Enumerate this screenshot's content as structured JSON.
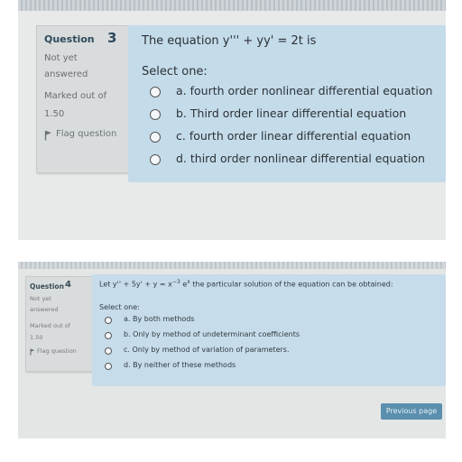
{
  "q3": {
    "question_label": "Question",
    "question_number": "3",
    "status": [
      "Not yet",
      "answered"
    ],
    "marked_out_of": "Marked out of",
    "marks": "1.50",
    "flag": "Flag question",
    "prompt": "The equation  y''' + yy' = 2t is",
    "select_one": "Select one:",
    "options": [
      "a. fourth order nonlinear differential equation",
      "b. Third order linear differential equation",
      "c. fourth order linear differential equation",
      "d. third  order nonlinear differential equation"
    ]
  },
  "q4": {
    "question_label": "Question",
    "question_number": "4",
    "status": [
      "Not yet",
      "answered"
    ],
    "marked_out_of": "Marked out of",
    "marks": "1.50",
    "flag": "Flag question",
    "prompt_lhs": "Let y'' + 5y' + y = x",
    "prompt_exp1": "−3",
    "prompt_e": " e",
    "prompt_exp2": "x",
    "prompt_rest": " the particular solution of the equation can be obtained:",
    "select_one": "Select one:",
    "options": [
      "a. By both methods",
      "b. Only by method of undeterminant coefficients",
      "c. Only by method of variation of parameters.",
      "d. By neither of these methods"
    ],
    "previous_page": "Previous page"
  },
  "colors": {
    "question_panel": "#c4dbea",
    "info_panel": "#d9dcdc",
    "button": "#5b8fae"
  },
  "icons": [
    "flag-icon",
    "radio-icon"
  ]
}
